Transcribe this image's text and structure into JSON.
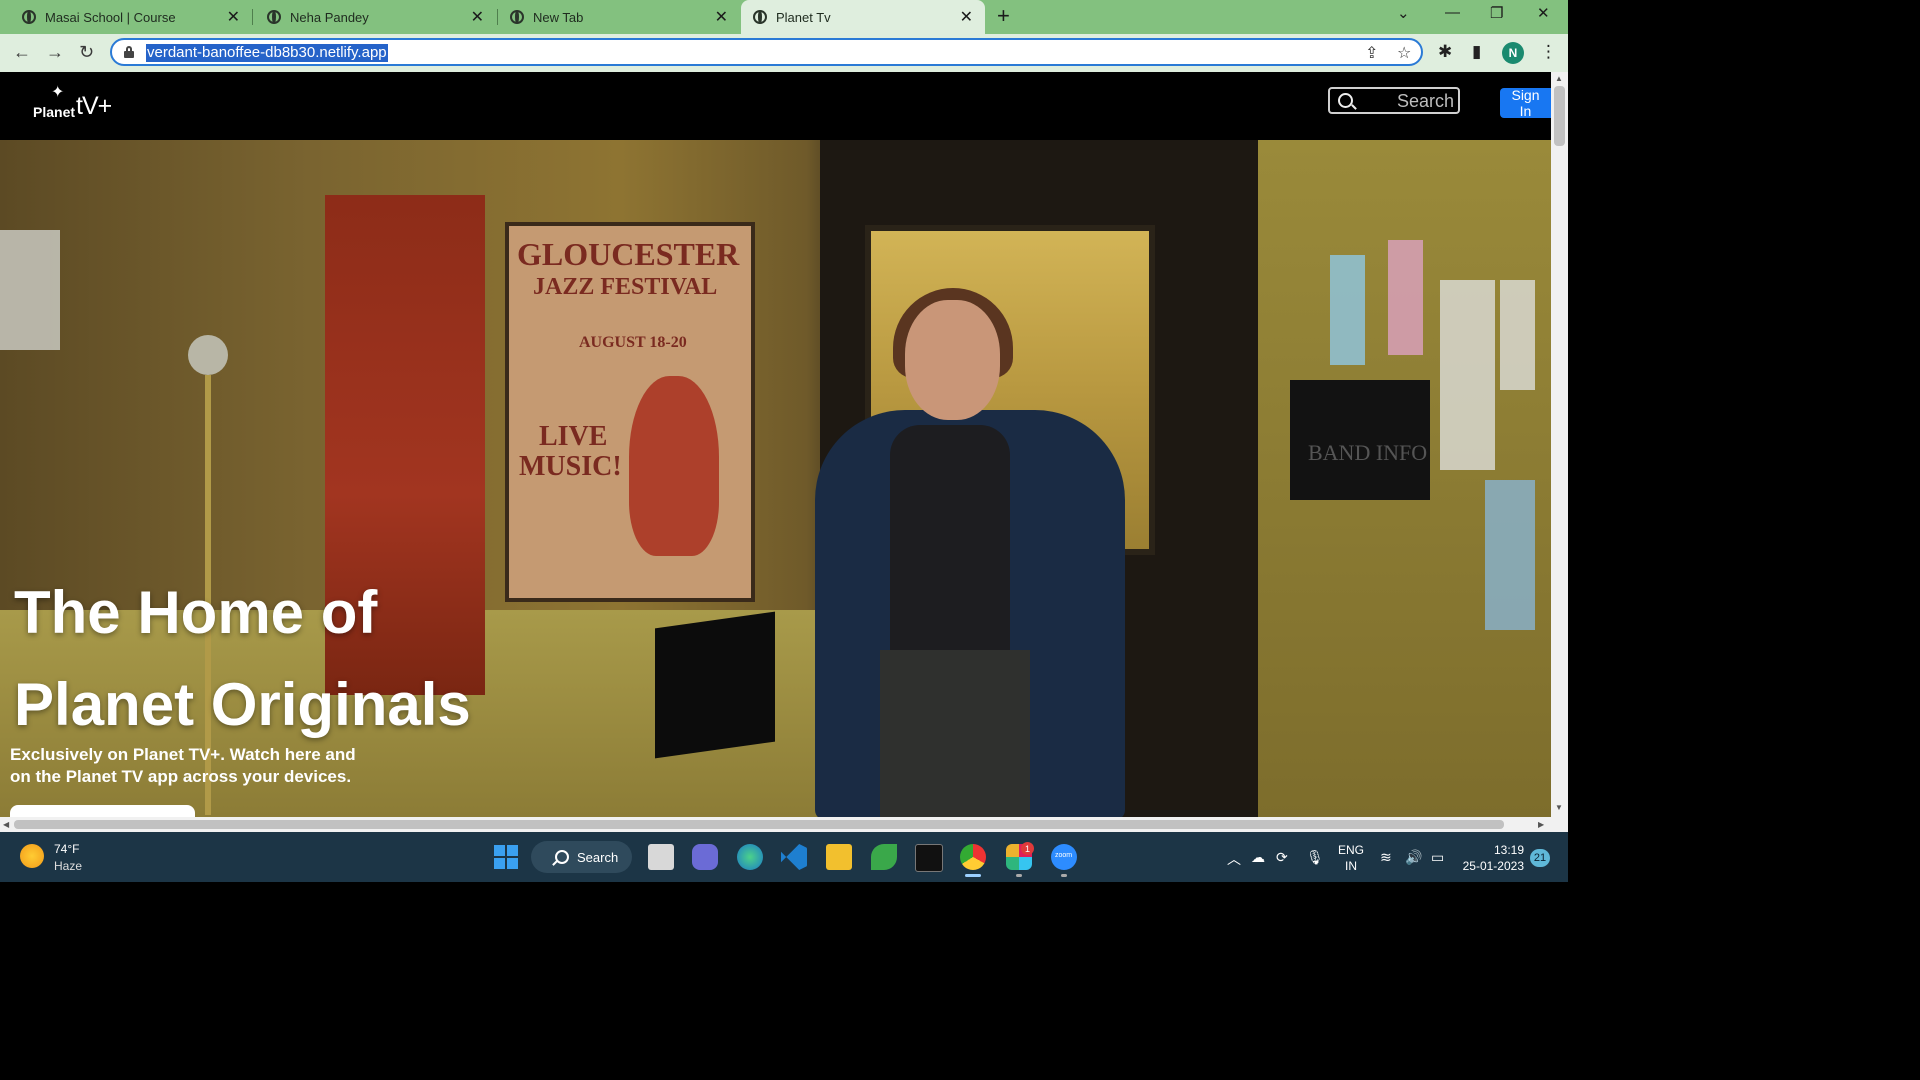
{
  "browser": {
    "tabs": [
      {
        "title": "Masai School | Course",
        "active": false
      },
      {
        "title": "Neha Pandey",
        "active": false
      },
      {
        "title": "New Tab",
        "active": false
      },
      {
        "title": "Planet Tv",
        "active": true
      }
    ],
    "new_tab_icon": "plus",
    "url": "verdant-banoffee-db8b30.netlify.app",
    "profile_initial": "N",
    "window_controls": [
      "chevron-down",
      "minimize",
      "restore",
      "close"
    ],
    "colors": {
      "tabbar": "#83c17f",
      "toolbar": "#dfeede",
      "omnibox_border": "#2a7ad6",
      "url_highlight": "#2563c9"
    }
  },
  "site": {
    "logo": {
      "planet": "Planet",
      "tv": "tV+"
    },
    "search": {
      "placeholder": "Search"
    },
    "signin_label": "Sign In",
    "hero": {
      "title_line1": "The Home of",
      "title_line2": "Planet Originals",
      "subtitle_line1": "Exclusively on Planet TV+. Watch here and",
      "subtitle_line2": "on the Planet TV app across your devices.",
      "poster_lines": [
        "GLOUCESTER",
        "JAZZ FESTIVAL",
        "AUGUST 18-20",
        "LIVE",
        "MUSIC!"
      ],
      "mailbox_text": "BAND INFO"
    },
    "colors": {
      "nav_bg": "#000000",
      "signin_bg": "#1877f2"
    }
  },
  "taskbar": {
    "weather": {
      "temp": "74°F",
      "condition": "Haze"
    },
    "search_label": "Search",
    "apps": [
      "windows-start-icon",
      "search",
      "task-view-icon",
      "teams-icon",
      "edge-icon",
      "vscode-icon",
      "file-explorer-icon",
      "mongodb-compass-icon",
      "terminal-icon",
      "chrome-icon",
      "slack-icon",
      "zoom-icon"
    ],
    "slack_badge": "1",
    "zoom_label": "zoom",
    "language": {
      "line1": "ENG",
      "line2": "IN"
    },
    "clock": {
      "time": "13:19",
      "date": "25-01-2023"
    },
    "notification_count": "21"
  }
}
